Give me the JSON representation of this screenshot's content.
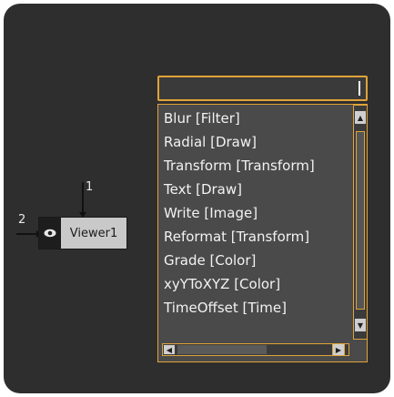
{
  "node_graph": {
    "viewer_node": {
      "label": "Viewer1",
      "input_top_label": "1",
      "input_left_label": "2",
      "icon": "eye-icon"
    }
  },
  "search_popup": {
    "input_value": "",
    "items": [
      "Blur  [Filter]",
      "Radial  [Draw]",
      "Transform  [Transform]",
      "Text  [Draw]",
      "Write  [Image]",
      "Reformat  [Transform]",
      "Grade  [Color]",
      "xyYToXYZ  [Color]",
      "TimeOffset  [Time]"
    ],
    "scroll_up_icon": "triangle-up-icon",
    "scroll_down_icon": "triangle-down-icon",
    "scroll_left_icon": "triangle-left-icon",
    "scroll_right_icon": "triangle-right-icon"
  },
  "colors": {
    "canvas": "#2e2e2e",
    "accent": "#e0a33a",
    "list_bg": "#4a4a4a",
    "node_body": "#c9c9c9"
  }
}
